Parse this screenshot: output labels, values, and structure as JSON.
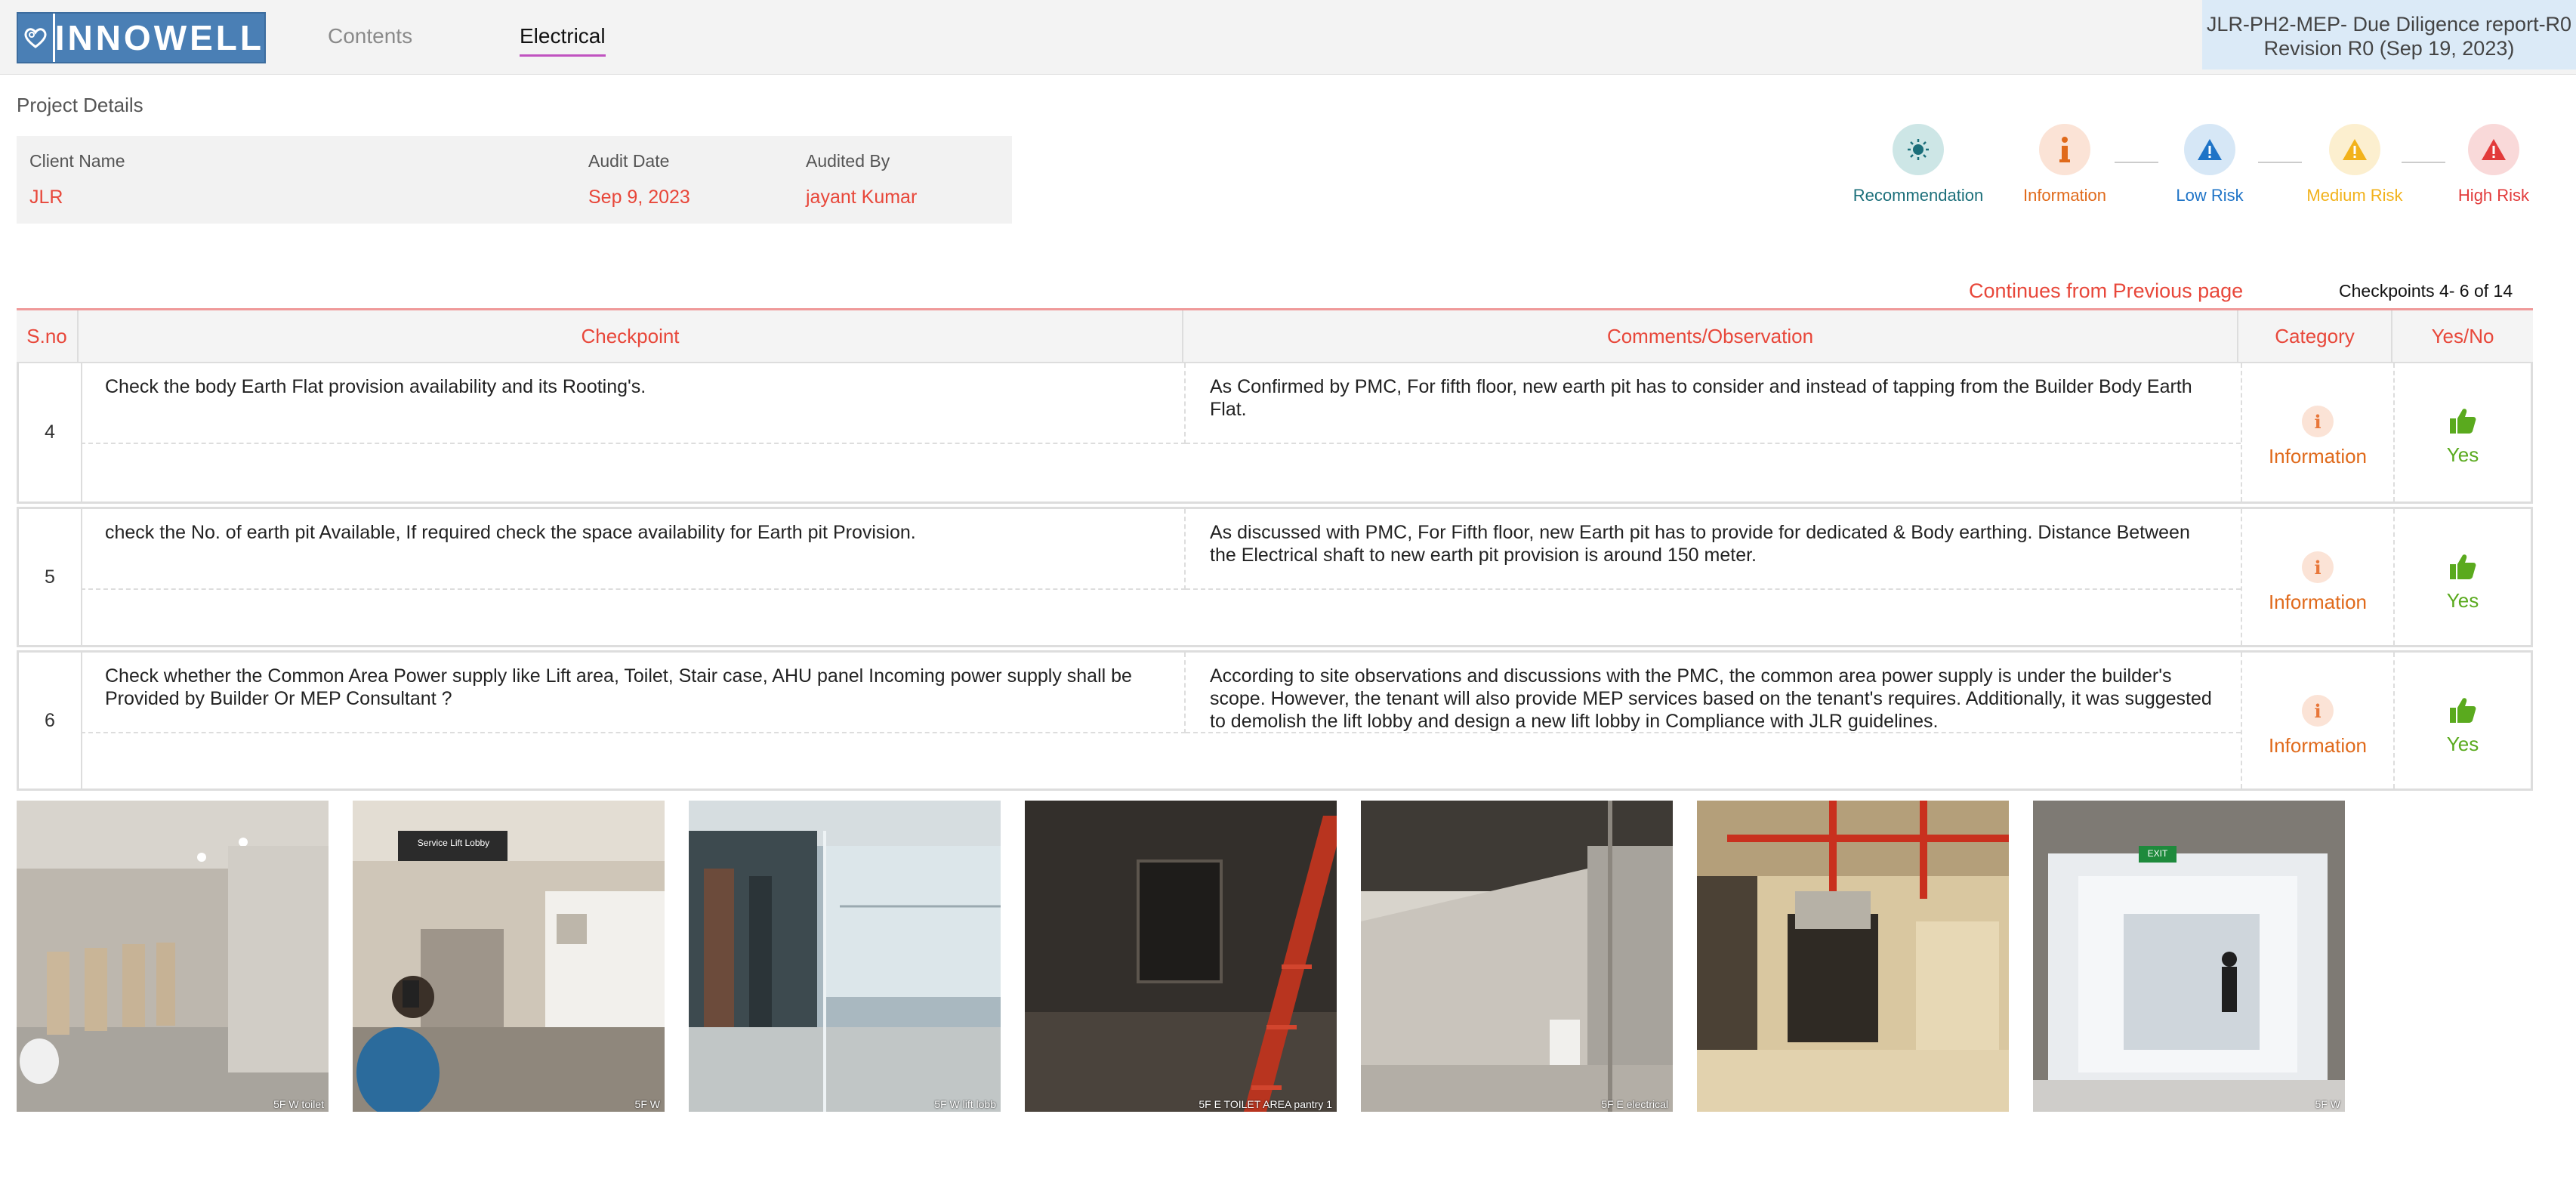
{
  "brand": {
    "name": "INNOWELL",
    "color": "#4a7fb5"
  },
  "nav": {
    "contents": "Contents",
    "electrical": "Electrical"
  },
  "report": {
    "title": "JLR-PH2-MEP- Due Diligence report-R0",
    "revision": "Revision R0 (Sep 19, 2023)"
  },
  "project": {
    "label": "Project Details",
    "client_name_label": "Client Name",
    "client_name": "JLR",
    "audit_date_label": "Audit Date",
    "audit_date": "Sep 9, 2023",
    "audited_by_label": "Audited By",
    "audited_by": "jayant Kumar"
  },
  "legend": [
    {
      "label": "Recommendation",
      "icon": "bulb-icon",
      "color": "#1b6f7a",
      "bg": "#cde6e6"
    },
    {
      "label": "Information",
      "icon": "info-icon",
      "color": "#e06a1b",
      "bg": "#fbe3d6"
    },
    {
      "label": "Low Risk",
      "icon": "warning-icon",
      "color": "#1f74c7",
      "bg": "#d6e7f6"
    },
    {
      "label": "Medium Risk",
      "icon": "warning-icon",
      "color": "#f2b21b",
      "bg": "#fcefcf"
    },
    {
      "label": "High Risk",
      "icon": "warning-icon",
      "color": "#e23b3b",
      "bg": "#f9d9d9"
    }
  ],
  "pagination": {
    "continues": "Continues from  Previous page",
    "checkpoints": "Checkpoints 4- 6 of 14"
  },
  "table": {
    "headers": {
      "sno": "S.no",
      "checkpoint": "Checkpoint",
      "comments": "Comments/Observation",
      "category": "Category",
      "yesno": "Yes/No"
    },
    "rows": [
      {
        "sno": "4",
        "checkpoint": "Check the  body Earth Flat provision availability and its Rooting's.",
        "comment": "As Confirmed by PMC, For fifth floor, new earth pit has to consider and instead of tapping from the Builder Body Earth Flat.",
        "category": "Information",
        "answer": "Yes"
      },
      {
        "sno": "5",
        "checkpoint": "check the No. of earth pit Available, If required check the space availability for Earth pit Provision.",
        "comment": "As discussed with PMC, For Fifth floor, new Earth pit has to provide for dedicated & Body earthing. Distance Between the Electrical shaft to new earth pit provision is around 150 meter.",
        "category": "Information",
        "answer": "Yes"
      },
      {
        "sno": "6",
        "checkpoint": "Check whether the Common Area Power supply like Lift area, Toilet, Stair case, AHU panel Incoming power supply shall be Provided by Builder Or MEP Consultant ?",
        "comment": "According to site observations and discussions with the PMC, the common area power supply is under the builder's scope. However, the tenant will also provide MEP services based on the tenant's requires. Additionally, it was suggested to demolish the lift lobby and design a new lift lobby in Compliance with JLR guidelines.",
        "category": "Information",
        "answer": "Yes"
      }
    ]
  },
  "photos": {
    "items": [
      {
        "caption": "5F W toilet"
      },
      {
        "caption": "5F W",
        "sign": "Service Lift Lobby"
      },
      {
        "caption": "5F W lift lobb"
      },
      {
        "caption": "5F E TOILET AREA pantry 1"
      },
      {
        "caption": "5F E electrical"
      },
      {
        "caption": ""
      },
      {
        "caption": "5F W",
        "sign": "EXIT"
      }
    ]
  }
}
